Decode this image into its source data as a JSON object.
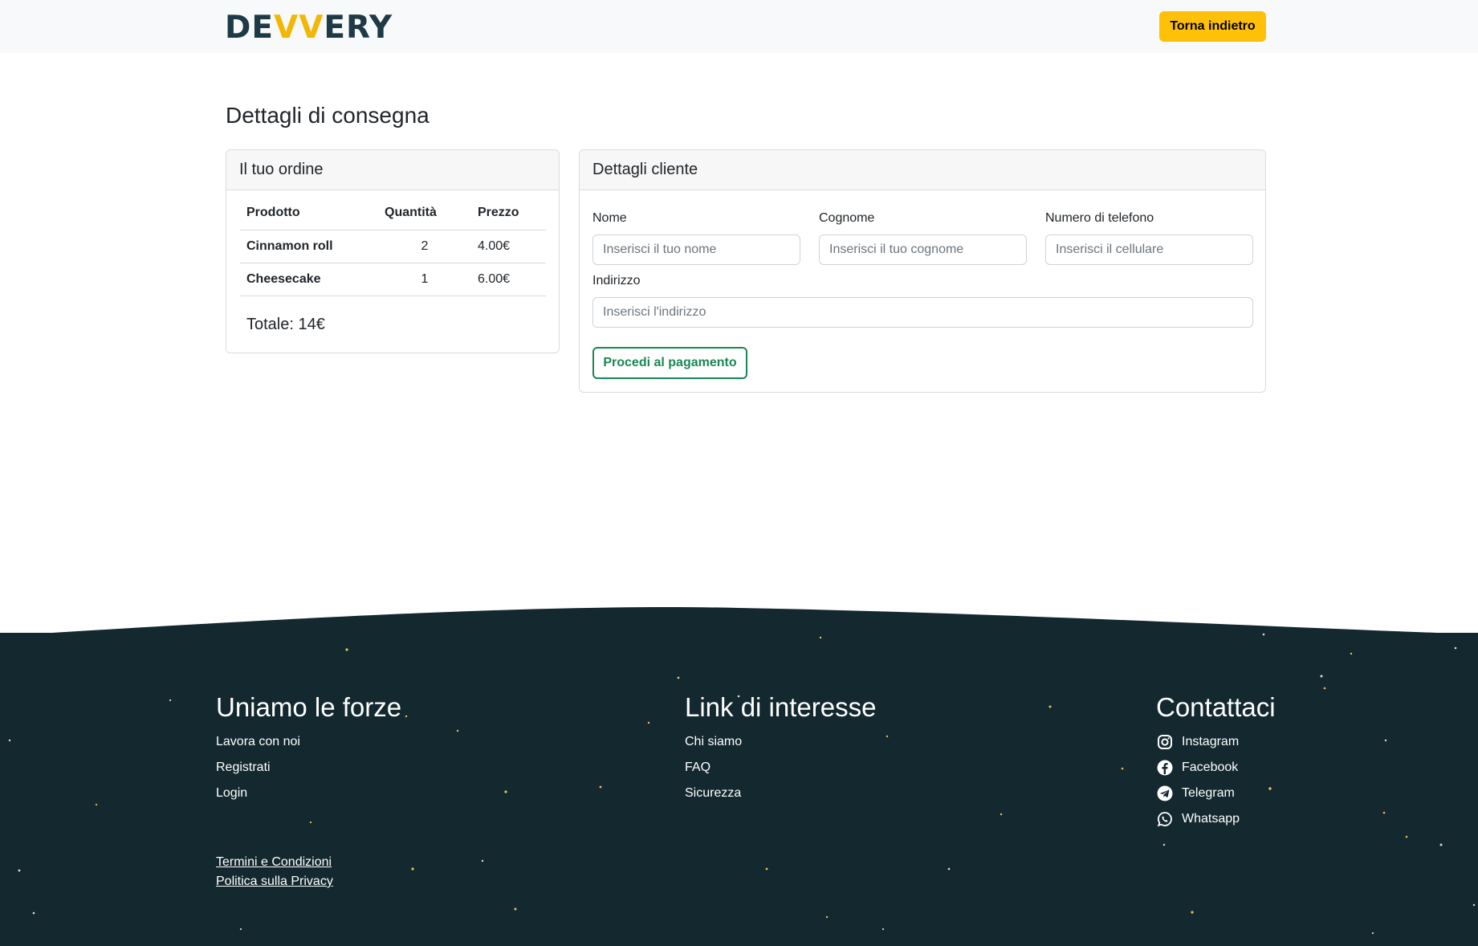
{
  "navbar": {
    "logo_pre": "DE",
    "logo_accent": "VV",
    "logo_post": "ERY",
    "back_label": "Torna indietro"
  },
  "page": {
    "title": "Dettagli di consegna"
  },
  "order": {
    "header": "Il tuo ordine",
    "columns": [
      "Prodotto",
      "Quantità",
      "Prezzo"
    ],
    "rows": [
      {
        "product": "Cinnamon roll",
        "qty": "2",
        "price": "4.00€"
      },
      {
        "product": "Cheesecake",
        "qty": "1",
        "price": "6.00€"
      }
    ],
    "total": "Totale: 14€"
  },
  "client": {
    "header": "Dettagli cliente",
    "name_label": "Nome",
    "name_placeholder": "Inserisci il tuo nome",
    "surname_label": "Cognome",
    "surname_placeholder": "Inserisci il tuo cognome",
    "phone_label": "Numero di telefono",
    "phone_placeholder": "Inserisci il cellulare",
    "address_label": "Indirizzo",
    "address_placeholder": "Inserisci l'indirizzo",
    "submit_label": "Procedi al pagamento"
  },
  "footer": {
    "col1": {
      "heading": "Uniamo le forze",
      "links": [
        "Lavora con noi",
        "Registrati",
        "Login"
      ]
    },
    "col2": {
      "heading": "Link di interesse",
      "links": [
        "Chi siamo",
        "FAQ",
        "Sicurezza"
      ]
    },
    "col3": {
      "heading": "Contattaci",
      "links": [
        {
          "label": "Instagram",
          "icon": "instagram-icon"
        },
        {
          "label": "Facebook",
          "icon": "facebook-icon"
        },
        {
          "label": "Telegram",
          "icon": "telegram-icon"
        },
        {
          "label": "Whatsapp",
          "icon": "whatsapp-icon"
        }
      ]
    },
    "legal": [
      "Termini e Condizioni",
      "Politica sulla Privacy"
    ]
  },
  "colors": {
    "accent": "#ffc107",
    "brand_dark": "#1e3a46",
    "footer_bg": "#13282f",
    "success": "#198754"
  }
}
